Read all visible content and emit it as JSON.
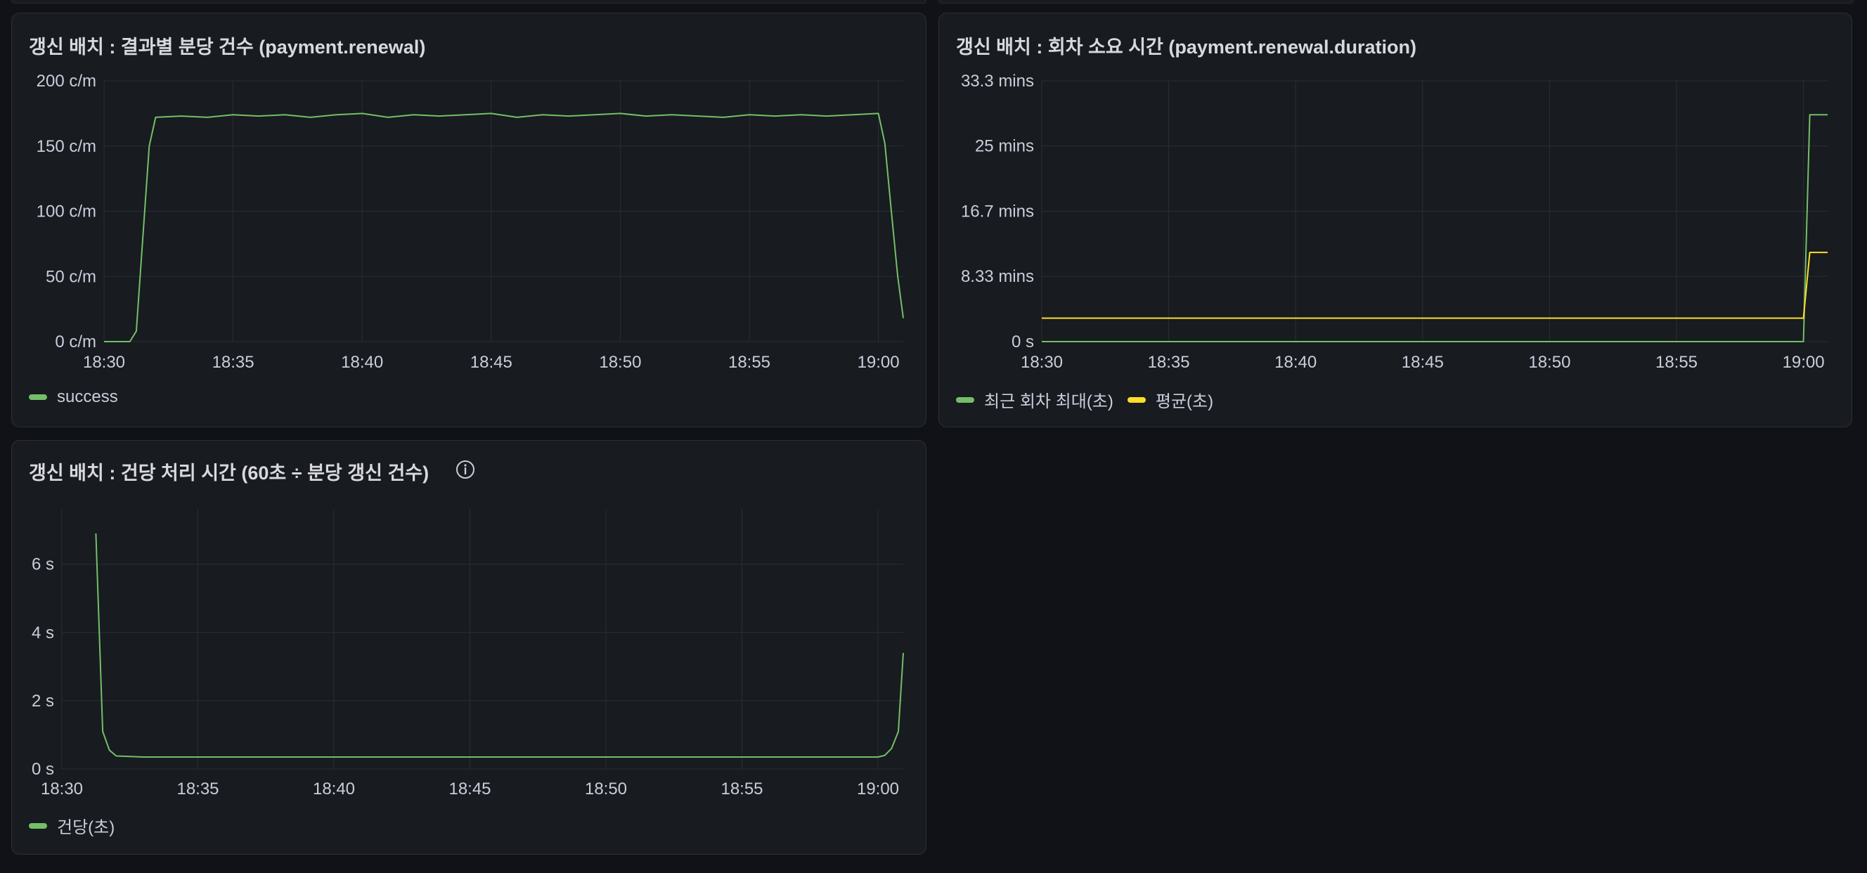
{
  "panels": [
    {
      "title": "갱신 배치 : 결과별 분당 건수 (payment.renewal)",
      "chart_data": {
        "type": "line",
        "title": "갱신 배치 : 결과별 분당 건수 (payment.renewal)",
        "unit": "c/m",
        "x_range": [
          "18:30",
          "19:01"
        ],
        "x_ticks": [
          "18:30",
          "18:35",
          "18:40",
          "18:45",
          "18:50",
          "18:55",
          "19:00"
        ],
        "y_ticks": [
          "0 c/m",
          "50 c/m",
          "100 c/m",
          "150 c/m",
          "200 c/m"
        ],
        "ylim": [
          0,
          200
        ],
        "grid": true,
        "legend_position": "bottom-left",
        "series": [
          {
            "name": "success",
            "color": "#73bf69",
            "points": [
              [
                "18:30",
                0
              ],
              [
                "18:31",
                0
              ],
              [
                "18:31:15",
                8
              ],
              [
                "18:31:45",
                150
              ],
              [
                "18:32",
                172
              ],
              [
                "18:33",
                173
              ],
              [
                "18:34",
                172
              ],
              [
                "18:35",
                174
              ],
              [
                "18:36",
                173
              ],
              [
                "18:37",
                174
              ],
              [
                "18:38",
                172
              ],
              [
                "18:39",
                174
              ],
              [
                "18:40",
                175
              ],
              [
                "18:41",
                172
              ],
              [
                "18:42",
                174
              ],
              [
                "18:43",
                173
              ],
              [
                "18:44",
                174
              ],
              [
                "18:45",
                175
              ],
              [
                "18:46",
                172
              ],
              [
                "18:47",
                174
              ],
              [
                "18:48",
                173
              ],
              [
                "18:49",
                174
              ],
              [
                "18:50",
                175
              ],
              [
                "18:51",
                173
              ],
              [
                "18:52",
                174
              ],
              [
                "18:53",
                173
              ],
              [
                "18:54",
                172
              ],
              [
                "18:55",
                174
              ],
              [
                "18:56",
                173
              ],
              [
                "18:57",
                174
              ],
              [
                "18:58",
                173
              ],
              [
                "18:59",
                174
              ],
              [
                "19:00",
                175
              ],
              [
                "19:00:15",
                152
              ],
              [
                "19:00:30",
                100
              ],
              [
                "19:00:45",
                50
              ],
              [
                "19:01",
                18
              ]
            ]
          }
        ]
      },
      "legend": [
        {
          "name": "success",
          "color": "#73bf69"
        }
      ]
    },
    {
      "title": "갱신 배치 : 회차 소요 시간 (payment.renewal.duration)",
      "chart_data": {
        "type": "line",
        "title": "갱신 배치 : 회차 소요 시간 (payment.renewal.duration)",
        "unit": "mins",
        "x_range": [
          "18:30",
          "19:01"
        ],
        "x_ticks": [
          "18:30",
          "18:35",
          "18:40",
          "18:45",
          "18:50",
          "18:55",
          "19:00"
        ],
        "y_ticks": [
          "0 s",
          "8.33 mins",
          "16.7 mins",
          "25 mins",
          "33.3 mins"
        ],
        "ylim": [
          0,
          33.33
        ],
        "grid": true,
        "legend_position": "bottom-left",
        "series": [
          {
            "name": "최근 회차 최대(초)",
            "color": "#73bf69",
            "points": [
              [
                "18:30",
                0
              ],
              [
                "19:00",
                0
              ],
              [
                "19:00:15",
                29
              ],
              [
                "19:01",
                29
              ]
            ]
          },
          {
            "name": "평균(초)",
            "color": "#fade2a",
            "points": [
              [
                "18:30",
                3
              ],
              [
                "19:00",
                3
              ],
              [
                "19:00:15",
                11.4
              ],
              [
                "19:01",
                11.4
              ]
            ]
          }
        ]
      },
      "legend": [
        {
          "name": "최근 회차 최대(초)",
          "color": "#73bf69"
        },
        {
          "name": "평균(초)",
          "color": "#fade2a"
        }
      ]
    },
    {
      "title": "갱신 배치 : 건당 처리 시간 (60초 ÷ 분당 갱신 건수)",
      "info_icon": "info-icon",
      "chart_data": {
        "type": "line",
        "title": "갱신 배치 : 건당 처리 시간 (60초 ÷ 분당 갱신 건수)",
        "unit": "s",
        "x_range": [
          "18:30",
          "19:01"
        ],
        "x_ticks": [
          "18:30",
          "18:35",
          "18:40",
          "18:45",
          "18:50",
          "18:55",
          "19:00"
        ],
        "y_ticks": [
          "0 s",
          "2 s",
          "4 s",
          "6 s"
        ],
        "ylim": [
          0,
          7.6
        ],
        "grid": true,
        "legend_position": "bottom-left",
        "series": [
          {
            "name": "건당(초)",
            "color": "#73bf69",
            "points": [
              [
                "18:31:15",
                6.9
              ],
              [
                "18:31:30",
                1.1
              ],
              [
                "18:31:45",
                0.55
              ],
              [
                "18:32",
                0.38
              ],
              [
                "18:33",
                0.35
              ],
              [
                "18:40",
                0.35
              ],
              [
                "18:45",
                0.35
              ],
              [
                "18:50",
                0.35
              ],
              [
                "18:55",
                0.35
              ],
              [
                "19:00",
                0.35
              ],
              [
                "19:00:15",
                0.4
              ],
              [
                "19:00:30",
                0.6
              ],
              [
                "19:00:45",
                1.1
              ],
              [
                "19:01",
                3.4
              ]
            ]
          }
        ]
      },
      "legend": [
        {
          "name": "건당(초)",
          "color": "#73bf69"
        }
      ]
    }
  ]
}
